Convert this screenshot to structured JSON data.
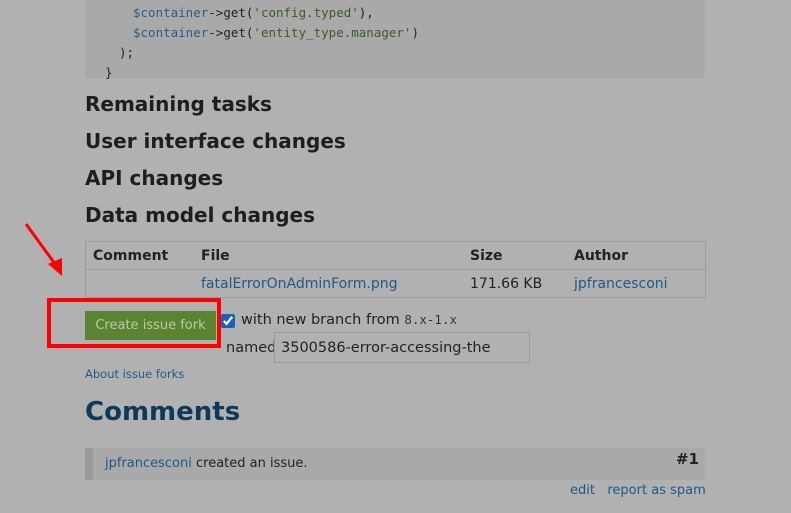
{
  "code": {
    "line1_var": "$container",
    "line1_call": "->get(",
    "line1_str": "'config.typed'",
    "line1_end": "),",
    "line2_var": "$container",
    "line2_call": "->get(",
    "line2_str": "'entity_type.manager'",
    "line2_end": ")",
    "line3": ");",
    "line4": "}"
  },
  "sections": [
    "Remaining tasks",
    "User interface changes",
    "API changes",
    "Data model changes"
  ],
  "files_table": {
    "headers": [
      "Comment",
      "File",
      "Size",
      "Author"
    ],
    "rows": [
      {
        "comment": "",
        "file": "fatalErrorOnAdminForm.png",
        "size": "171.66 KB",
        "author": "jpfrancesconi"
      }
    ]
  },
  "fork": {
    "button_label": "Create issue fork",
    "checkbox_label": "with new branch from",
    "branch": "8.x-1.x",
    "checked": true,
    "named_label": "named",
    "branch_name": "3500586-error-accessing-the",
    "about_link": "About issue forks"
  },
  "comments": {
    "heading": "Comments",
    "items": [
      {
        "author": "jpfrancesconi",
        "text": "created an issue.",
        "number": "#1",
        "actions": [
          "edit",
          "report as spam"
        ]
      }
    ]
  },
  "colors": {
    "annotation": "#ff0000",
    "button": "#5a8432",
    "link": "#1c5a88"
  }
}
